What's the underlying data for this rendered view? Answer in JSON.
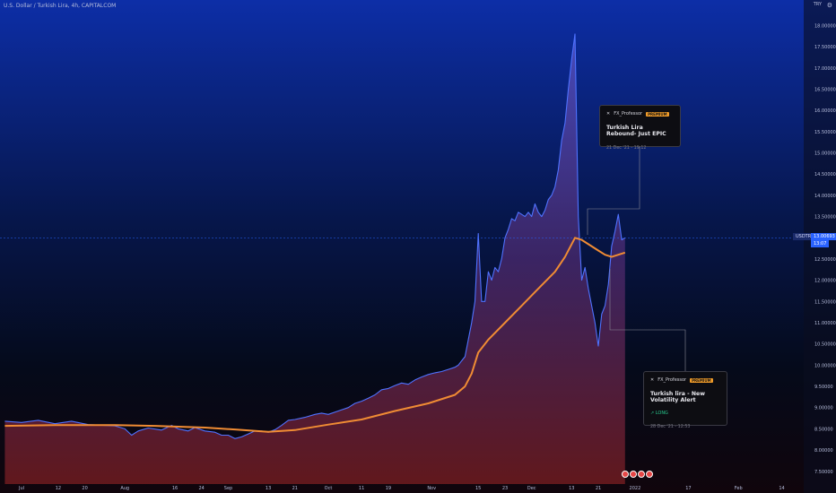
{
  "header": {
    "title": "U.S. Dollar / Turkish Lira, 4h, CAPITALCOM",
    "currency": "TRY"
  },
  "price_labels": {
    "symbol": "USDTRY",
    "price": "13.00693",
    "time": "13:07"
  },
  "cards": [
    {
      "author": "FX_Professor",
      "badge": "PREMIUM",
      "title": "Turkish Lira Rebound- Just EPIC",
      "tag": "",
      "meta": "21 Dec '21 - 19:12"
    },
    {
      "author": "FX_Professor",
      "badge": "PREMIUM",
      "title": "Turkish lira - New Volatility Alert",
      "tag": "↗ LONG",
      "meta": "28 Dec '21 - 12:53"
    }
  ],
  "colors": {
    "price_line": "#4f72ff",
    "ma_line": "#f08c34",
    "last_price_line": "#2962ff",
    "card_badge": "#f29d2a"
  },
  "chart_data": {
    "type": "line",
    "title": "U.S. Dollar / Turkish Lira, 4h, CAPITALCOM",
    "ylim": [
      7.2,
      18.6
    ],
    "grid": false,
    "y_ticks": [
      7.5,
      8.0,
      8.5,
      9.0,
      9.5,
      10.0,
      10.5,
      11.0,
      11.5,
      12.0,
      12.5,
      13.0,
      13.5,
      14.0,
      14.5,
      15.0,
      15.5,
      16.0,
      16.5,
      17.0,
      17.5,
      18.0
    ],
    "y_tick_labels": [
      "7.50000",
      "8.00000",
      "8.50000",
      "9.00000",
      "9.50000",
      "10.00000",
      "10.50000",
      "11.00000",
      "11.50000",
      "12.00000",
      "12.50000",
      "13.00000",
      "13.50000",
      "14.00000",
      "14.50000",
      "15.00000",
      "15.50000",
      "16.00000",
      "16.50000",
      "17.00000",
      "17.50000",
      "18.00000"
    ],
    "x_ticks": [
      {
        "label": "Jul",
        "day": 0
      },
      {
        "label": "12",
        "day": 11
      },
      {
        "label": "20",
        "day": 19
      },
      {
        "label": "Aug",
        "day": 31
      },
      {
        "label": "16",
        "day": 46
      },
      {
        "label": "24",
        "day": 54
      },
      {
        "label": "Sep",
        "day": 62
      },
      {
        "label": "13",
        "day": 74
      },
      {
        "label": "21",
        "day": 82
      },
      {
        "label": "Oct",
        "day": 92
      },
      {
        "label": "11",
        "day": 102
      },
      {
        "label": "19",
        "day": 110
      },
      {
        "label": "Nov",
        "day": 123
      },
      {
        "label": "15",
        "day": 137
      },
      {
        "label": "23",
        "day": 145
      },
      {
        "label": "Dec",
        "day": 153
      },
      {
        "label": "13",
        "day": 165
      },
      {
        "label": "21",
        "day": 173
      },
      {
        "label": "2022",
        "day": 184
      },
      {
        "label": "17",
        "day": 200
      },
      {
        "label": "Feb",
        "day": 215
      },
      {
        "label": "14",
        "day": 228
      }
    ],
    "series": [
      {
        "values": [
          [
            -5,
            8.68
          ],
          [
            0,
            8.65
          ],
          [
            5,
            8.7
          ],
          [
            10,
            8.62
          ],
          [
            15,
            8.68
          ],
          [
            20,
            8.6
          ],
          [
            25,
            8.58
          ],
          [
            28,
            8.57
          ],
          [
            31,
            8.5
          ],
          [
            33,
            8.35
          ],
          [
            35,
            8.45
          ],
          [
            38,
            8.52
          ],
          [
            42,
            8.47
          ],
          [
            45,
            8.58
          ],
          [
            47,
            8.5
          ],
          [
            50,
            8.45
          ],
          [
            52,
            8.53
          ],
          [
            55,
            8.45
          ],
          [
            58,
            8.42
          ],
          [
            60,
            8.35
          ],
          [
            62,
            8.35
          ],
          [
            64,
            8.27
          ],
          [
            66,
            8.31
          ],
          [
            68,
            8.38
          ],
          [
            70,
            8.45
          ],
          [
            72,
            8.45
          ],
          [
            74,
            8.42
          ],
          [
            76,
            8.48
          ],
          [
            78,
            8.58
          ],
          [
            80,
            8.7
          ],
          [
            82,
            8.72
          ],
          [
            85,
            8.77
          ],
          [
            88,
            8.84
          ],
          [
            90,
            8.87
          ],
          [
            92,
            8.84
          ],
          [
            95,
            8.92
          ],
          [
            98,
            9.0
          ],
          [
            100,
            9.1
          ],
          [
            102,
            9.15
          ],
          [
            104,
            9.22
          ],
          [
            106,
            9.3
          ],
          [
            108,
            9.42
          ],
          [
            110,
            9.45
          ],
          [
            112,
            9.52
          ],
          [
            114,
            9.58
          ],
          [
            116,
            9.55
          ],
          [
            118,
            9.65
          ],
          [
            120,
            9.72
          ],
          [
            122,
            9.78
          ],
          [
            124,
            9.82
          ],
          [
            126,
            9.85
          ],
          [
            128,
            9.9
          ],
          [
            130,
            9.95
          ],
          [
            131,
            10.0
          ],
          [
            132,
            10.1
          ],
          [
            133,
            10.2
          ],
          [
            134,
            10.6
          ],
          [
            135,
            11.0
          ],
          [
            136,
            11.5
          ],
          [
            137,
            13.1
          ],
          [
            138,
            11.5
          ],
          [
            139,
            11.5
          ],
          [
            140,
            12.2
          ],
          [
            141,
            12.0
          ],
          [
            142,
            12.3
          ],
          [
            143,
            12.2
          ],
          [
            144,
            12.5
          ],
          [
            145,
            13.0
          ],
          [
            146,
            13.2
          ],
          [
            147,
            13.45
          ],
          [
            148,
            13.4
          ],
          [
            149,
            13.6
          ],
          [
            150,
            13.55
          ],
          [
            151,
            13.5
          ],
          [
            152,
            13.6
          ],
          [
            153,
            13.5
          ],
          [
            154,
            13.8
          ],
          [
            155,
            13.6
          ],
          [
            156,
            13.5
          ],
          [
            157,
            13.65
          ],
          [
            158,
            13.9
          ],
          [
            159,
            14.0
          ],
          [
            160,
            14.2
          ],
          [
            161,
            14.6
          ],
          [
            162,
            15.3
          ],
          [
            163,
            15.7
          ],
          [
            164,
            16.5
          ],
          [
            165,
            17.2
          ],
          [
            166,
            17.8
          ],
          [
            167,
            13.5
          ],
          [
            168,
            12.0
          ],
          [
            169,
            12.3
          ],
          [
            170,
            11.8
          ],
          [
            171,
            11.4
          ],
          [
            172,
            11.0
          ],
          [
            173,
            10.45
          ],
          [
            174,
            11.2
          ],
          [
            175,
            11.4
          ],
          [
            176,
            11.9
          ],
          [
            177,
            12.8
          ],
          [
            178,
            13.15
          ],
          [
            179,
            13.55
          ],
          [
            180,
            12.95
          ],
          [
            181,
            13.0
          ]
        ]
      },
      {
        "values": [
          [
            -5,
            8.57
          ],
          [
            10,
            8.59
          ],
          [
            28,
            8.59
          ],
          [
            40,
            8.57
          ],
          [
            55,
            8.53
          ],
          [
            65,
            8.48
          ],
          [
            74,
            8.43
          ],
          [
            82,
            8.47
          ],
          [
            92,
            8.6
          ],
          [
            102,
            8.72
          ],
          [
            112,
            8.92
          ],
          [
            122,
            9.1
          ],
          [
            130,
            9.3
          ],
          [
            133,
            9.5
          ],
          [
            135,
            9.8
          ],
          [
            137,
            10.3
          ],
          [
            140,
            10.6
          ],
          [
            145,
            11.0
          ],
          [
            150,
            11.4
          ],
          [
            155,
            11.8
          ],
          [
            160,
            12.2
          ],
          [
            163,
            12.55
          ],
          [
            165,
            12.85
          ],
          [
            166,
            13.0
          ],
          [
            168,
            12.95
          ],
          [
            170,
            12.85
          ],
          [
            173,
            12.7
          ],
          [
            175,
            12.6
          ],
          [
            177,
            12.55
          ],
          [
            179,
            12.6
          ],
          [
            181,
            12.65
          ]
        ]
      }
    ]
  }
}
